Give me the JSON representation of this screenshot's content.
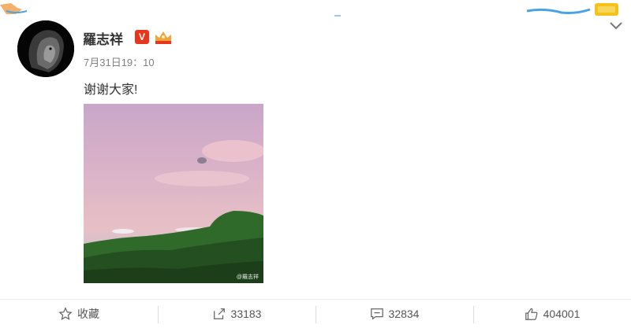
{
  "post": {
    "author": "羅志祥",
    "timestamp": "7月31日19：10",
    "text": "谢谢大家!",
    "verified_badge": "V",
    "watermark": "@羅志祥"
  },
  "actions": [
    {
      "label": "收藏",
      "icon": "star-icon"
    },
    {
      "label": "33183",
      "icon": "share-icon"
    },
    {
      "label": "32834",
      "icon": "comment-icon"
    },
    {
      "label": "404001",
      "icon": "like-icon"
    }
  ],
  "colors": {
    "badge": "#e8361c",
    "muted": "#808080",
    "divider": "#eeeeee"
  }
}
